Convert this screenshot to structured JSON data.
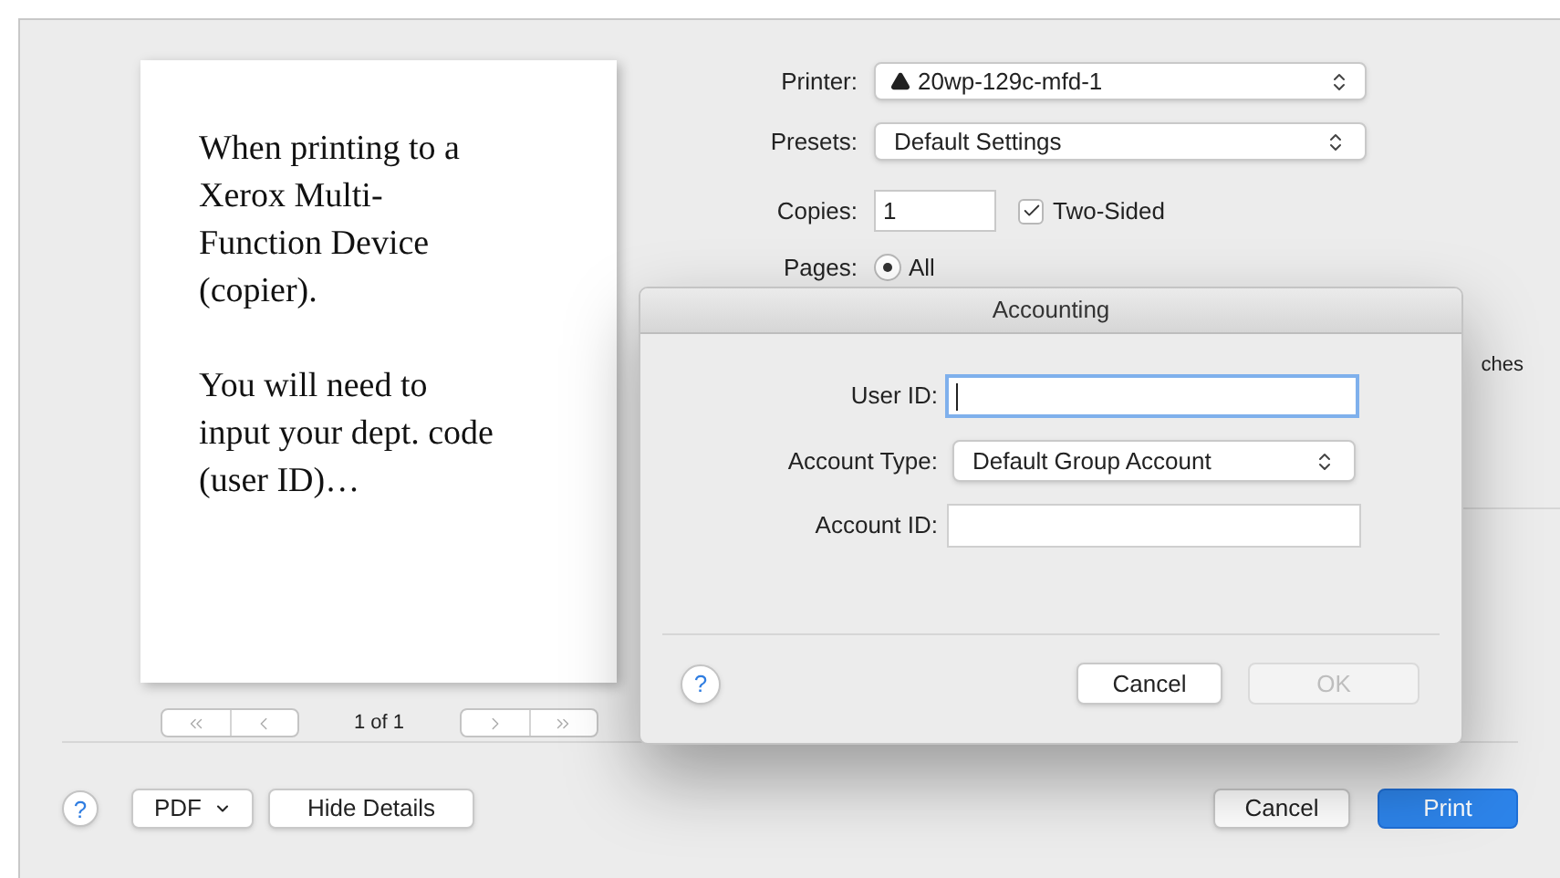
{
  "preview": {
    "paragraphs": [
      {
        "lines": [
          "When printing to a",
          "Xerox Multi-",
          "Function Device",
          "(copier)."
        ]
      },
      {
        "lines": [
          "You will need to",
          "input your dept. code",
          "(user ID)…"
        ]
      }
    ],
    "pager": {
      "status": "1 of 1"
    }
  },
  "settings": {
    "printer": {
      "label": "Printer:",
      "value": "20wp-129c-mfd-1",
      "warning": true
    },
    "presets": {
      "label": "Presets:",
      "value": "Default Settings"
    },
    "copies": {
      "label": "Copies:",
      "value": "1"
    },
    "two_sided": {
      "label": "Two-Sided",
      "checked": true
    },
    "pages": {
      "label": "Pages:",
      "option": "All",
      "selected": true
    },
    "hidden_fragment": "ches"
  },
  "sheet": {
    "title": "Accounting",
    "fields": [
      {
        "kind": "text",
        "label": "User ID:",
        "focused": true
      },
      {
        "kind": "popup",
        "label": "Account Type:",
        "value": "Default Group Account"
      },
      {
        "kind": "text",
        "label": "Account ID:",
        "focused": false
      }
    ],
    "help": "?",
    "buttons": [
      {
        "label": "Cancel",
        "disabled": false
      },
      {
        "label": "OK",
        "disabled": true
      }
    ]
  },
  "bottom_bar": {
    "help": "?",
    "pdf": "PDF",
    "hide_details": "Hide Details",
    "cancel": "Cancel",
    "print": "Print"
  }
}
